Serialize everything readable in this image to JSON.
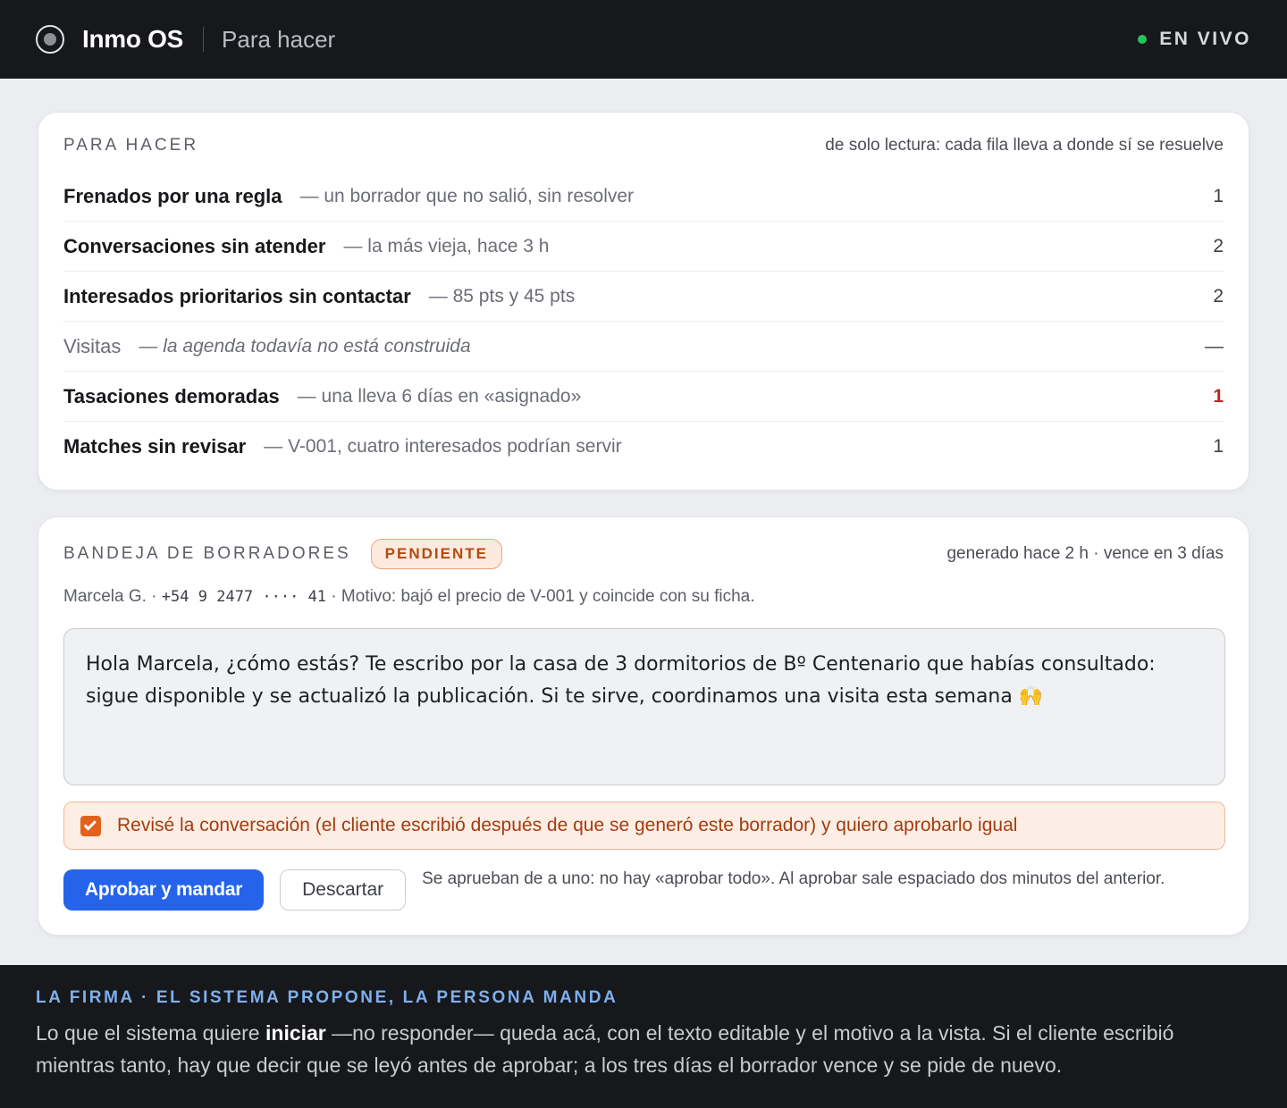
{
  "header": {
    "brand": "Inmo OS",
    "section": "Para hacer",
    "status_label": "EN VIVO",
    "status_color": "#22c55e"
  },
  "todo": {
    "heading": "PARA HACER",
    "note": "de solo lectura: cada fila lleva a donde sí se resuelve",
    "items": [
      {
        "title": "Frenados por una regla",
        "detail": "— un borrador que no salió, sin resolver",
        "count": "1"
      },
      {
        "title": "Conversaciones sin atender",
        "detail": "— la más vieja, hace 3 h",
        "count": "2"
      },
      {
        "title": "Interesados prioritarios sin contactar",
        "detail": "— 85 pts y 45 pts",
        "count": "2"
      },
      {
        "title": "Visitas",
        "detail": "— la agenda todavía no está construida",
        "count": "—"
      },
      {
        "title": "Tasaciones demoradas",
        "detail": "— una lleva 6 días en «asignado»",
        "count": "1"
      },
      {
        "title": "Matches sin revisar",
        "detail": "— V-001, cuatro interesados podrían servir",
        "count": "1"
      }
    ]
  },
  "drafts": {
    "heading": "BANDEJA DE BORRADORES",
    "badge": "PENDIENTE",
    "meta": "generado hace 2 h · vence en 3 días",
    "contact_name": "Marcela G. ·",
    "contact_phone": "+54 9 2477 ···· 41",
    "contact_reason": "· Motivo: bajó el precio de V-001 y coincide con su ficha.",
    "message": "Hola Marcela, ¿cómo estás? Te escribo por la casa de 3 dormitorios de Bº Centenario que habías consultado: sigue disponible y se actualizó la publicación. Si te sirve, coordinamos una visita esta semana 🙌",
    "confirm_label": "Revisé la conversación (el cliente escribió después de que se generó este borrador) y quiero aprobarlo igual",
    "confirm_checked": true,
    "approve_label": "Aprobar y mandar",
    "discard_label": "Descartar",
    "actions_note": "Se aprueban de a uno: no hay «aprobar todo». Al aprobar sale espaciado dos minutos del anterior."
  },
  "footer": {
    "kicker": "LA FIRMA · EL SISTEMA PROPONE, LA PERSONA MANDA",
    "text_before": "Lo que el sistema quiere ",
    "text_bold": "iniciar",
    "text_after": " —no responder— queda acá, con el texto editable y el motivo a la vista. Si el cliente escribió mientras tanto, hay que decir que se leyó antes de aprobar; a los tres días el borrador vence y se pide de nuevo."
  }
}
